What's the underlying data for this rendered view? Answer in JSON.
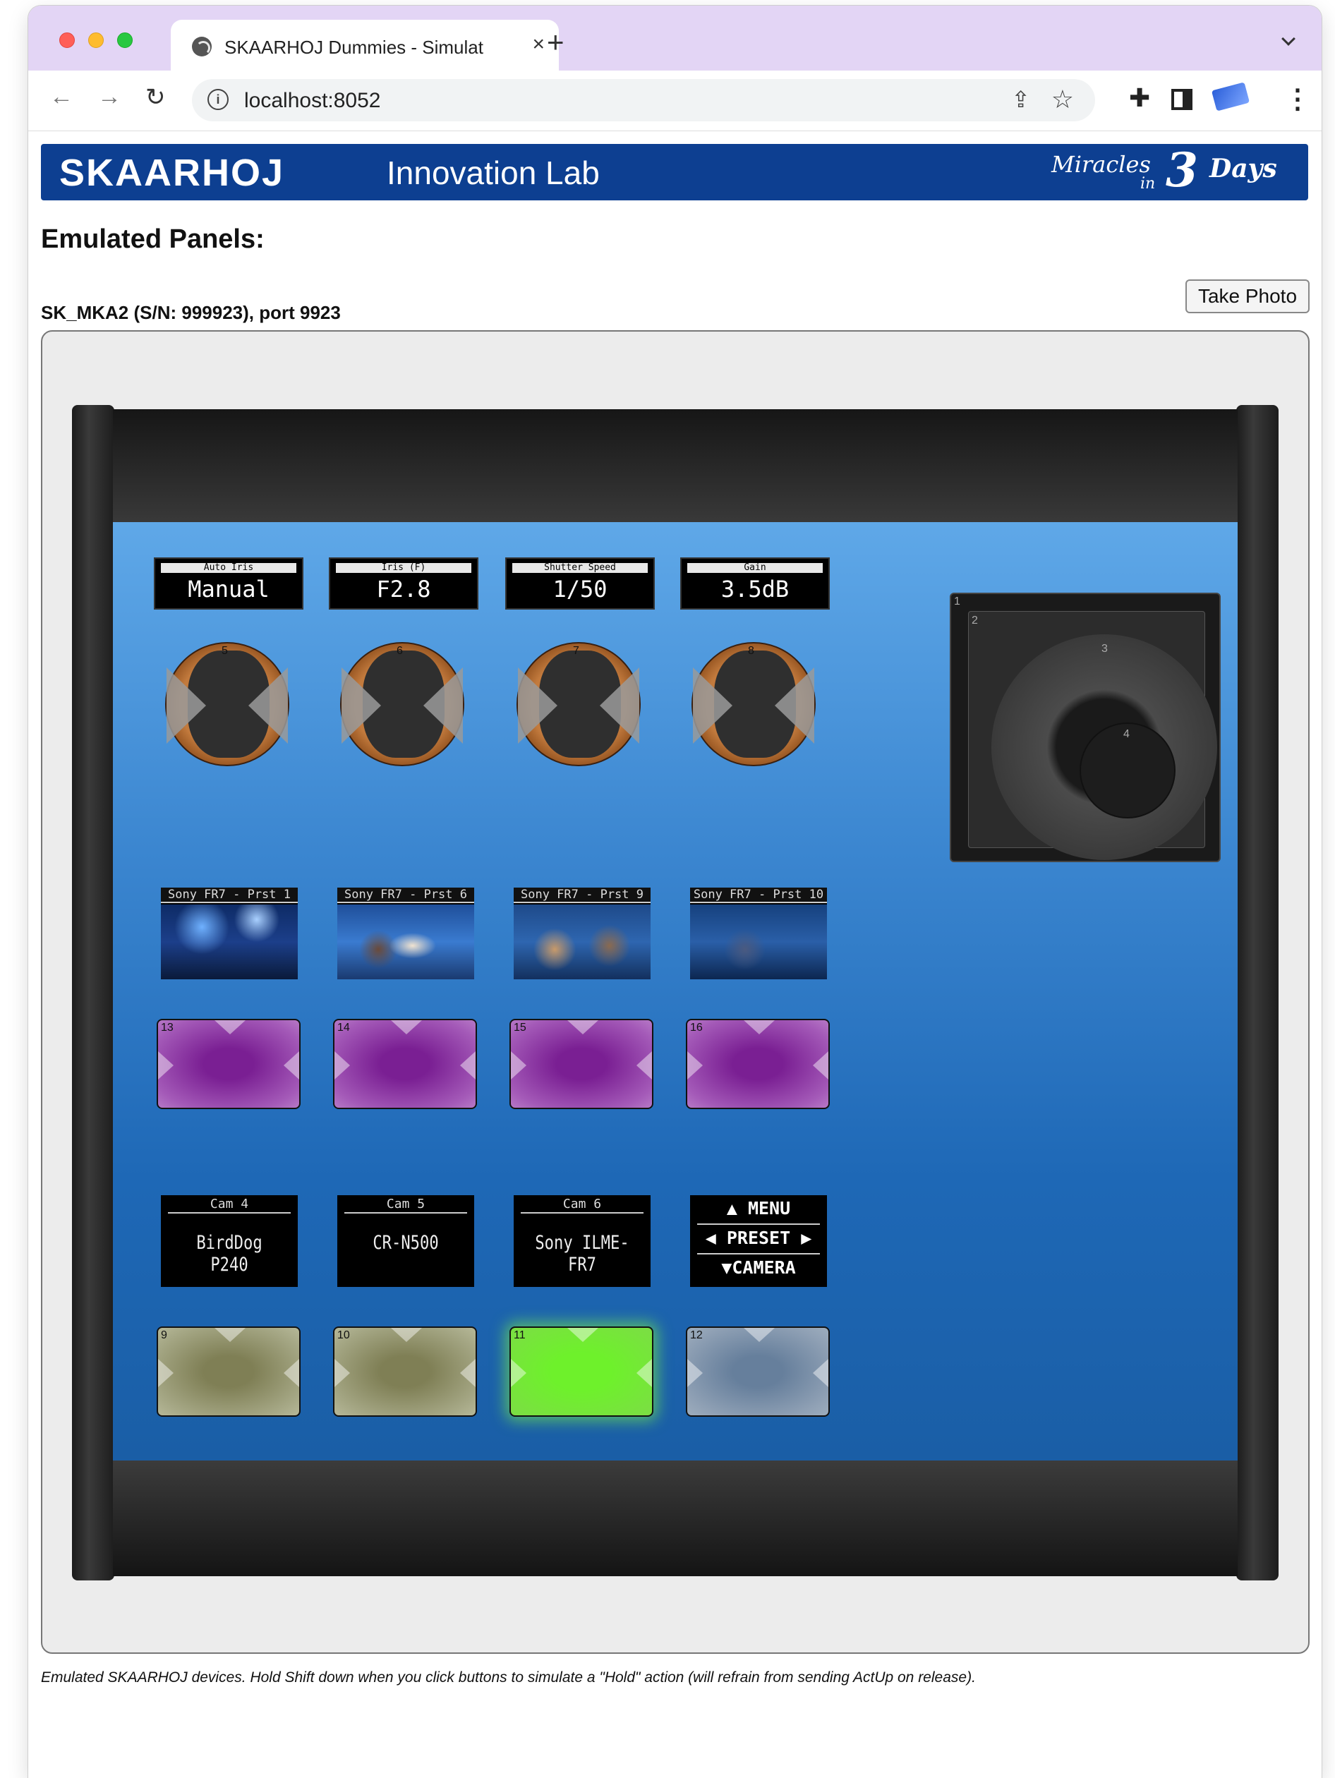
{
  "browser": {
    "tab_title": "SKAARHOJ Dummies - Simulat",
    "tab_close": "×",
    "new_tab": "+",
    "url": "localhost:8052"
  },
  "banner": {
    "brand": "SKAARHOJ",
    "lab": "Innovation Lab",
    "slogan_1": "Miracles",
    "slogan_2": "in",
    "slogan_3": "3",
    "slogan_4": "Days"
  },
  "page": {
    "heading": "Emulated Panels:",
    "panel_title": "SK_MKA2 (S/N: 999923), port 9923",
    "take_photo": "Take Photo",
    "footnote": "Emulated SKAARHOJ devices. Hold Shift down when you click buttons to simulate a \"Hold\" action (will refrain from sending ActUp on release)."
  },
  "displays": [
    {
      "label": "Auto Iris",
      "value": "Manual"
    },
    {
      "label": "Iris (F)",
      "value": "F2.8"
    },
    {
      "label": "Shutter Speed",
      "value": "1/50"
    },
    {
      "label": "Gain",
      "value": "3.5dB"
    }
  ],
  "encoders": [
    "5",
    "6",
    "7",
    "8"
  ],
  "joystick": {
    "n1": "1",
    "n2": "2",
    "n3": "3",
    "n4": "4"
  },
  "thumbnails": [
    "Sony FR7 - Prst 1",
    "Sony FR7 - Prst 6",
    "Sony FR7 - Prst 9",
    "Sony FR7 - Prst 10"
  ],
  "buttons_top": [
    "13",
    "14",
    "15",
    "16"
  ],
  "cams": [
    {
      "head": "Cam 4",
      "value": "BirdDog P240"
    },
    {
      "head": "Cam 5",
      "value": "CR-N500"
    },
    {
      "head": "Cam 6",
      "value": "Sony ILME-FR7"
    }
  ],
  "menu_display": {
    "r1": "▲ MENU",
    "r2": "◀ PRESET ▶",
    "r3": "▼CAMERA"
  },
  "buttons_bottom": [
    "9",
    "10",
    "11",
    "12"
  ],
  "colors": {
    "banner": "#0d3f91",
    "purple_button": "#7a1f93",
    "green_button": "#6ef12b",
    "olive_button": "#a6a886",
    "steel_button": "#90a1b5"
  }
}
